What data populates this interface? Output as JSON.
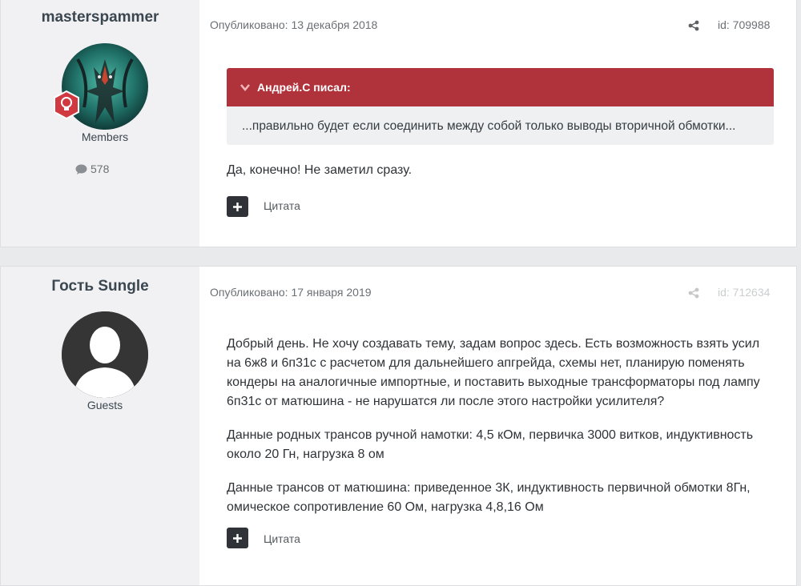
{
  "posts": [
    {
      "author": "masterspammer",
      "group": "Members",
      "post_count": "578",
      "date_label": "Опубликовано: 13 декабря 2018",
      "post_id": "id: 709988",
      "quote": {
        "header": "Андрей.С писал:",
        "text": "...правильно будет если соединить между собой только выводы вторичной обмотки..."
      },
      "paragraphs": [
        "Да, конечно! Не заметил сразу."
      ],
      "quote_action": "Цитата"
    },
    {
      "author": "Гость Sungle",
      "group": "Guests",
      "date_label": "Опубликовано: 17 января 2019",
      "post_id": "id: 712634",
      "paragraphs": [
        "Добрый день. Не хочу создавать тему, задам вопрос здесь. Есть возможность взять усил на 6ж8 и 6п31с с расчетом для дальнейшего апгрейда, схемы нет, планирую поменять кондеры на аналогичные импортные, и поставить выходные трансформаторы под лампу 6п31с от матюшина - не нарушатся ли после этого настройки усилителя?",
        "Данные родных трансов ручной намотки: 4,5 кОм, первичка 3000 витков, индуктивность около 20 Гн, нагрузка 8 ом",
        "Данные трансов от матюшина: приведенное 3К, индуктивность первичной обмотки 8Гн, омическое сопротивление 60 Ом, нагрузка 4,8,16 Ом"
      ],
      "quote_action": "Цитата"
    }
  ],
  "icons": {
    "badge": "lightbulb-badge-icon",
    "comment": "comment-icon",
    "share": "share-icon",
    "chevron": "chevron-down-icon",
    "plus": "plus-icon",
    "guest_avatar": "user-silhouette-icon"
  },
  "colors": {
    "quote_header": "#b0323a",
    "badge": "#d0393f",
    "button": "#2f3337",
    "author_bg": "#f1f1f3"
  }
}
